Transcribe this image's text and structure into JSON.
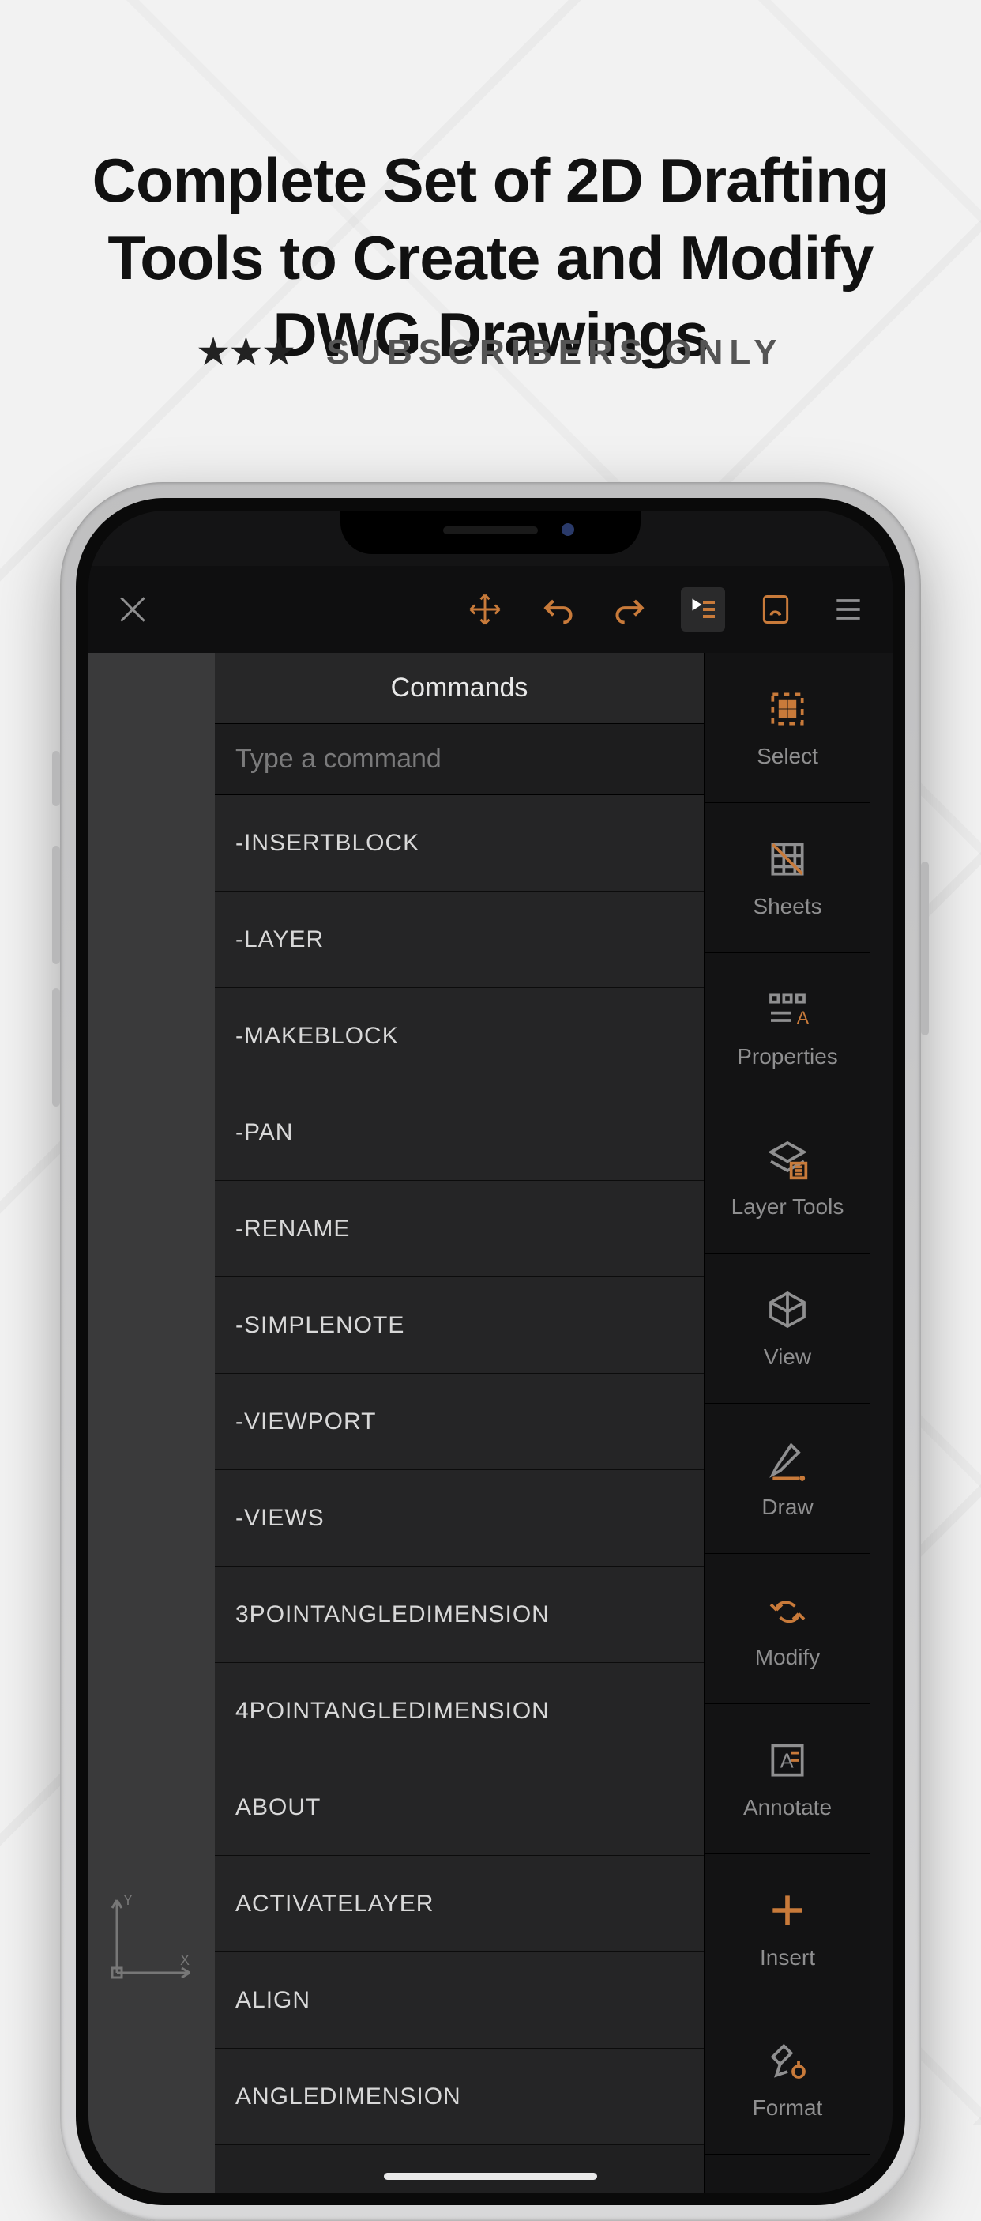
{
  "headline": "Complete Set of 2D Drafting Tools to Create and Modify DWG Drawings",
  "subline_text": "SUBSCRIBERS ONLY",
  "stars": "★★★",
  "colors": {
    "accent": "#c87a3a",
    "gray": "#8f8f90"
  },
  "topbar": {
    "close": "close",
    "move_icon": "move",
    "undo_icon": "undo",
    "redo_icon": "redo",
    "command_icon": "command-list",
    "hand_icon": "hand",
    "menu_icon": "menu"
  },
  "commands": {
    "title": "Commands",
    "placeholder": "Type a command",
    "items": [
      "-INSERTBLOCK",
      "-LAYER",
      "-MAKEBLOCK",
      "-PAN",
      "-RENAME",
      "-SIMPLENOTE",
      "-VIEWPORT",
      "-VIEWS",
      "3POINTANGLEDIMENSION",
      "4POINTANGLEDIMENSION",
      "ABOUT",
      "ACTIVATELAYER",
      "ALIGN",
      "ANGLEDIMENSION"
    ]
  },
  "rail": [
    {
      "label": "Select"
    },
    {
      "label": "Sheets"
    },
    {
      "label": "Properties"
    },
    {
      "label": "Layer Tools"
    },
    {
      "label": "View"
    },
    {
      "label": "Draw"
    },
    {
      "label": "Modify"
    },
    {
      "label": "Annotate"
    },
    {
      "label": "Insert"
    },
    {
      "label": "Format"
    }
  ],
  "axis": {
    "x": "X",
    "y": "Y"
  }
}
